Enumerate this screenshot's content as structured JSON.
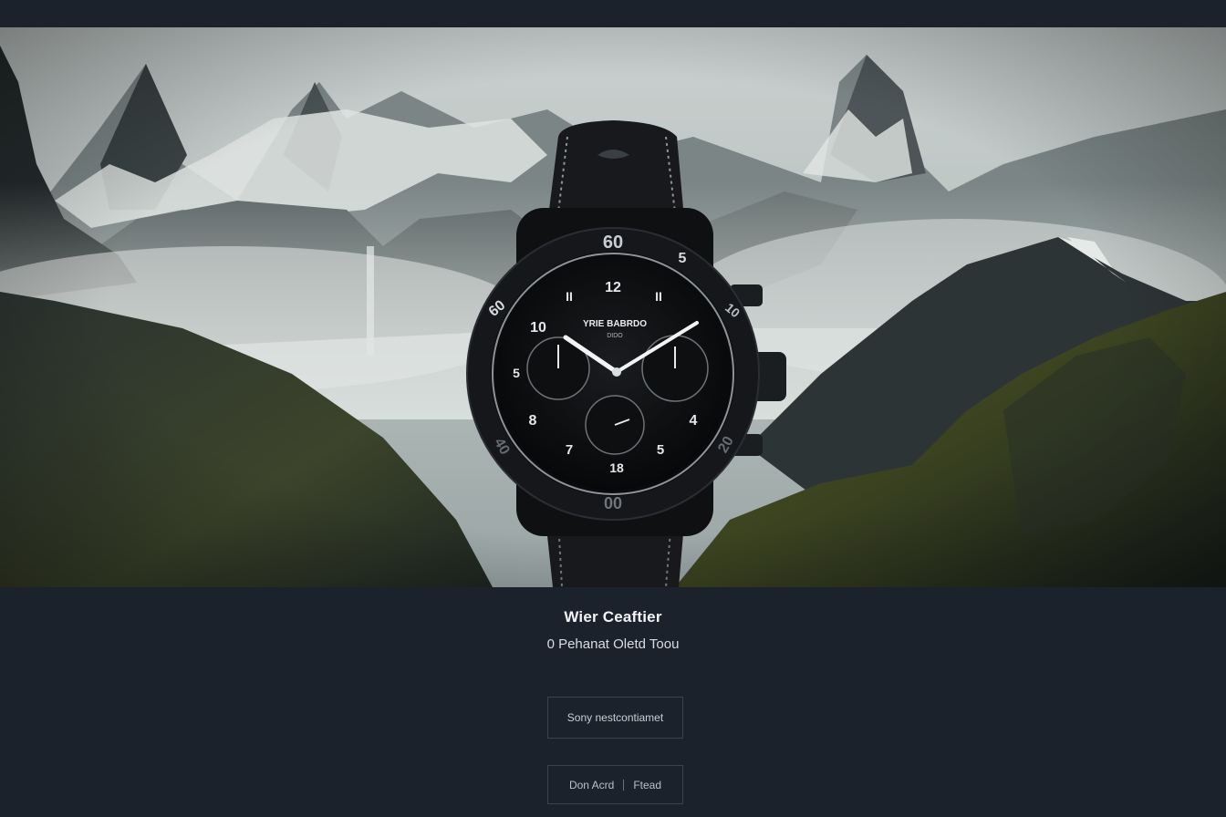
{
  "hero": {
    "watch_dial_text": "YRIE BABRDO",
    "watch_dial_sub": "DIDO",
    "bezel_top": "60",
    "bezel_bottom": "00"
  },
  "product": {
    "title": "Wier Ceaftier",
    "subtitle": "0 Pehanat Oletd Toou"
  },
  "actions": {
    "primary_label": "Sony nestcontiamet",
    "split_left": "Don Acrd",
    "split_right": "Ftead"
  }
}
